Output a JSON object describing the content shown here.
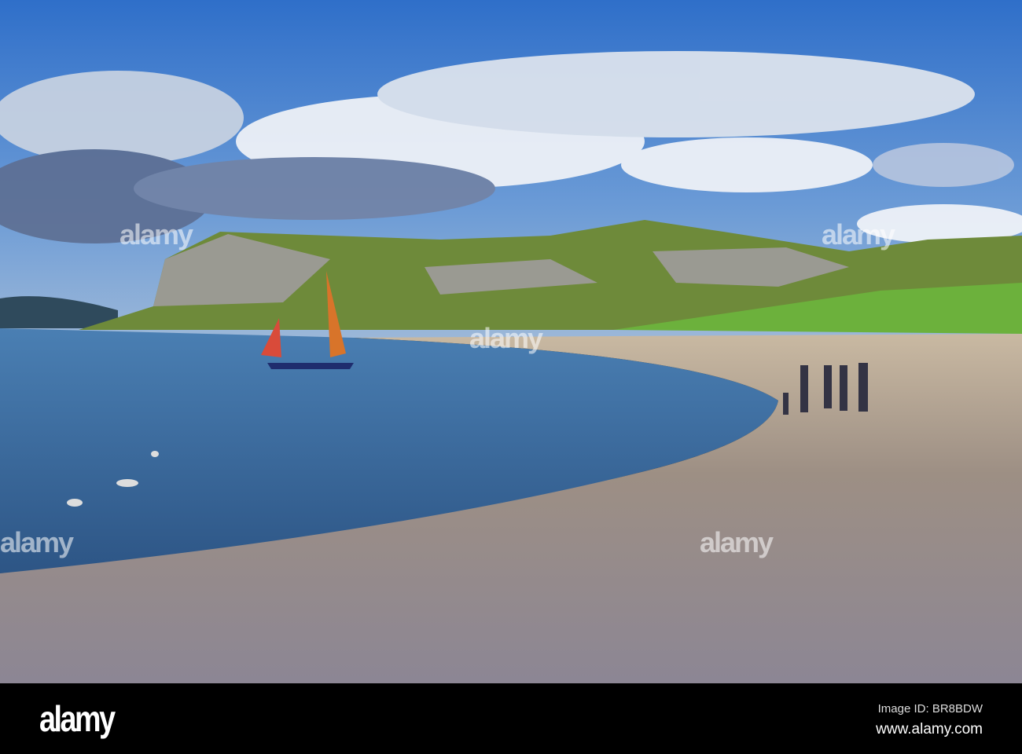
{
  "photo": {
    "subject": "beach-bay-headland"
  },
  "watermark": {
    "text": "alamy"
  },
  "footer": {
    "logo": "alamy",
    "image_id": "Image ID: BR8BDW",
    "url": "www.alamy.com"
  }
}
